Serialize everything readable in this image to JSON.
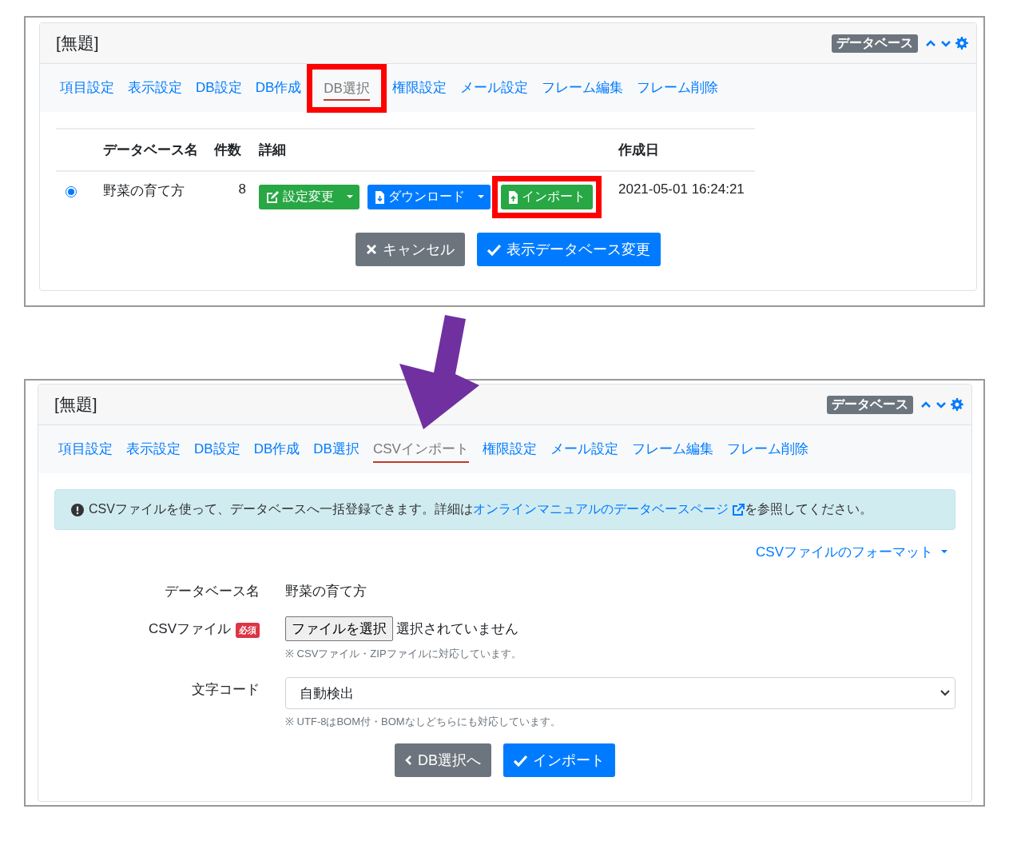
{
  "panels": [
    {
      "kind": "db-select",
      "title": "[無題]",
      "badge": "データベース",
      "tabs": [
        {
          "label": "項目設定",
          "selected": false,
          "highlighted": false
        },
        {
          "label": "表示設定",
          "selected": false,
          "highlighted": false
        },
        {
          "label": "DB設定",
          "selected": false,
          "highlighted": false
        },
        {
          "label": "DB作成",
          "selected": false,
          "highlighted": false
        },
        {
          "label": "DB選択",
          "selected": true,
          "highlighted": true
        },
        {
          "label": "権限設定",
          "selected": false,
          "highlighted": false
        },
        {
          "label": "メール設定",
          "selected": false,
          "highlighted": false
        },
        {
          "label": "フレーム編集",
          "selected": false,
          "highlighted": false
        },
        {
          "label": "フレーム削除",
          "selected": false,
          "highlighted": false
        }
      ],
      "table": {
        "columns": [
          "データベース名",
          "件数",
          "詳細",
          "作成日"
        ],
        "rows": [
          {
            "selected": true,
            "name": "野菜の育て方",
            "count": "8",
            "created": "2021-05-01 16:24:21",
            "buttons": [
              {
                "kind": "edit",
                "label": "設定変更",
                "dropdown": true,
                "highlighted": false
              },
              {
                "kind": "download",
                "label": "ダウンロード",
                "dropdown": true,
                "highlighted": false
              },
              {
                "kind": "import",
                "label": "インポート",
                "dropdown": false,
                "highlighted": true
              }
            ]
          }
        ]
      },
      "actions": [
        {
          "kind": "cancel",
          "label": "キャンセル"
        },
        {
          "kind": "submit",
          "label": "表示データベース変更"
        }
      ]
    },
    {
      "kind": "csv-import",
      "title": "[無題]",
      "badge": "データベース",
      "tabs": [
        {
          "label": "項目設定",
          "selected": false,
          "highlighted": false
        },
        {
          "label": "表示設定",
          "selected": false,
          "highlighted": false
        },
        {
          "label": "DB設定",
          "selected": false,
          "highlighted": false
        },
        {
          "label": "DB作成",
          "selected": false,
          "highlighted": false
        },
        {
          "label": "DB選択",
          "selected": false,
          "highlighted": false
        },
        {
          "label": "CSVインポート",
          "selected": true,
          "highlighted": false
        },
        {
          "label": "権限設定",
          "selected": false,
          "highlighted": false
        },
        {
          "label": "メール設定",
          "selected": false,
          "highlighted": false
        },
        {
          "label": "フレーム編集",
          "selected": false,
          "highlighted": false
        },
        {
          "label": "フレーム削除",
          "selected": false,
          "highlighted": false
        }
      ],
      "alert": {
        "text_before": "CSVファイルを使って、データベースへ一括登録できます。詳細は",
        "link": "オンラインマニュアルのデータベースページ",
        "text_after": "を参照してください。"
      },
      "format_link": "CSVファイルのフォーマット",
      "fields": [
        {
          "kind": "text",
          "label": "データベース名",
          "value": "野菜の育て方"
        },
        {
          "kind": "file",
          "label": "CSVファイル",
          "required": "必須",
          "button": "ファイルを選択",
          "value": "選択されていません",
          "help": "※ CSVファイル・ZIPファイルに対応しています。"
        },
        {
          "kind": "select",
          "label": "文字コード",
          "value": "自動検出",
          "help": "※ UTF-8はBOM付・BOMなしどちらにも対応しています。"
        }
      ],
      "actions": [
        {
          "kind": "back",
          "label": "DB選択へ"
        },
        {
          "kind": "submit",
          "label": "インポート"
        }
      ]
    }
  ]
}
